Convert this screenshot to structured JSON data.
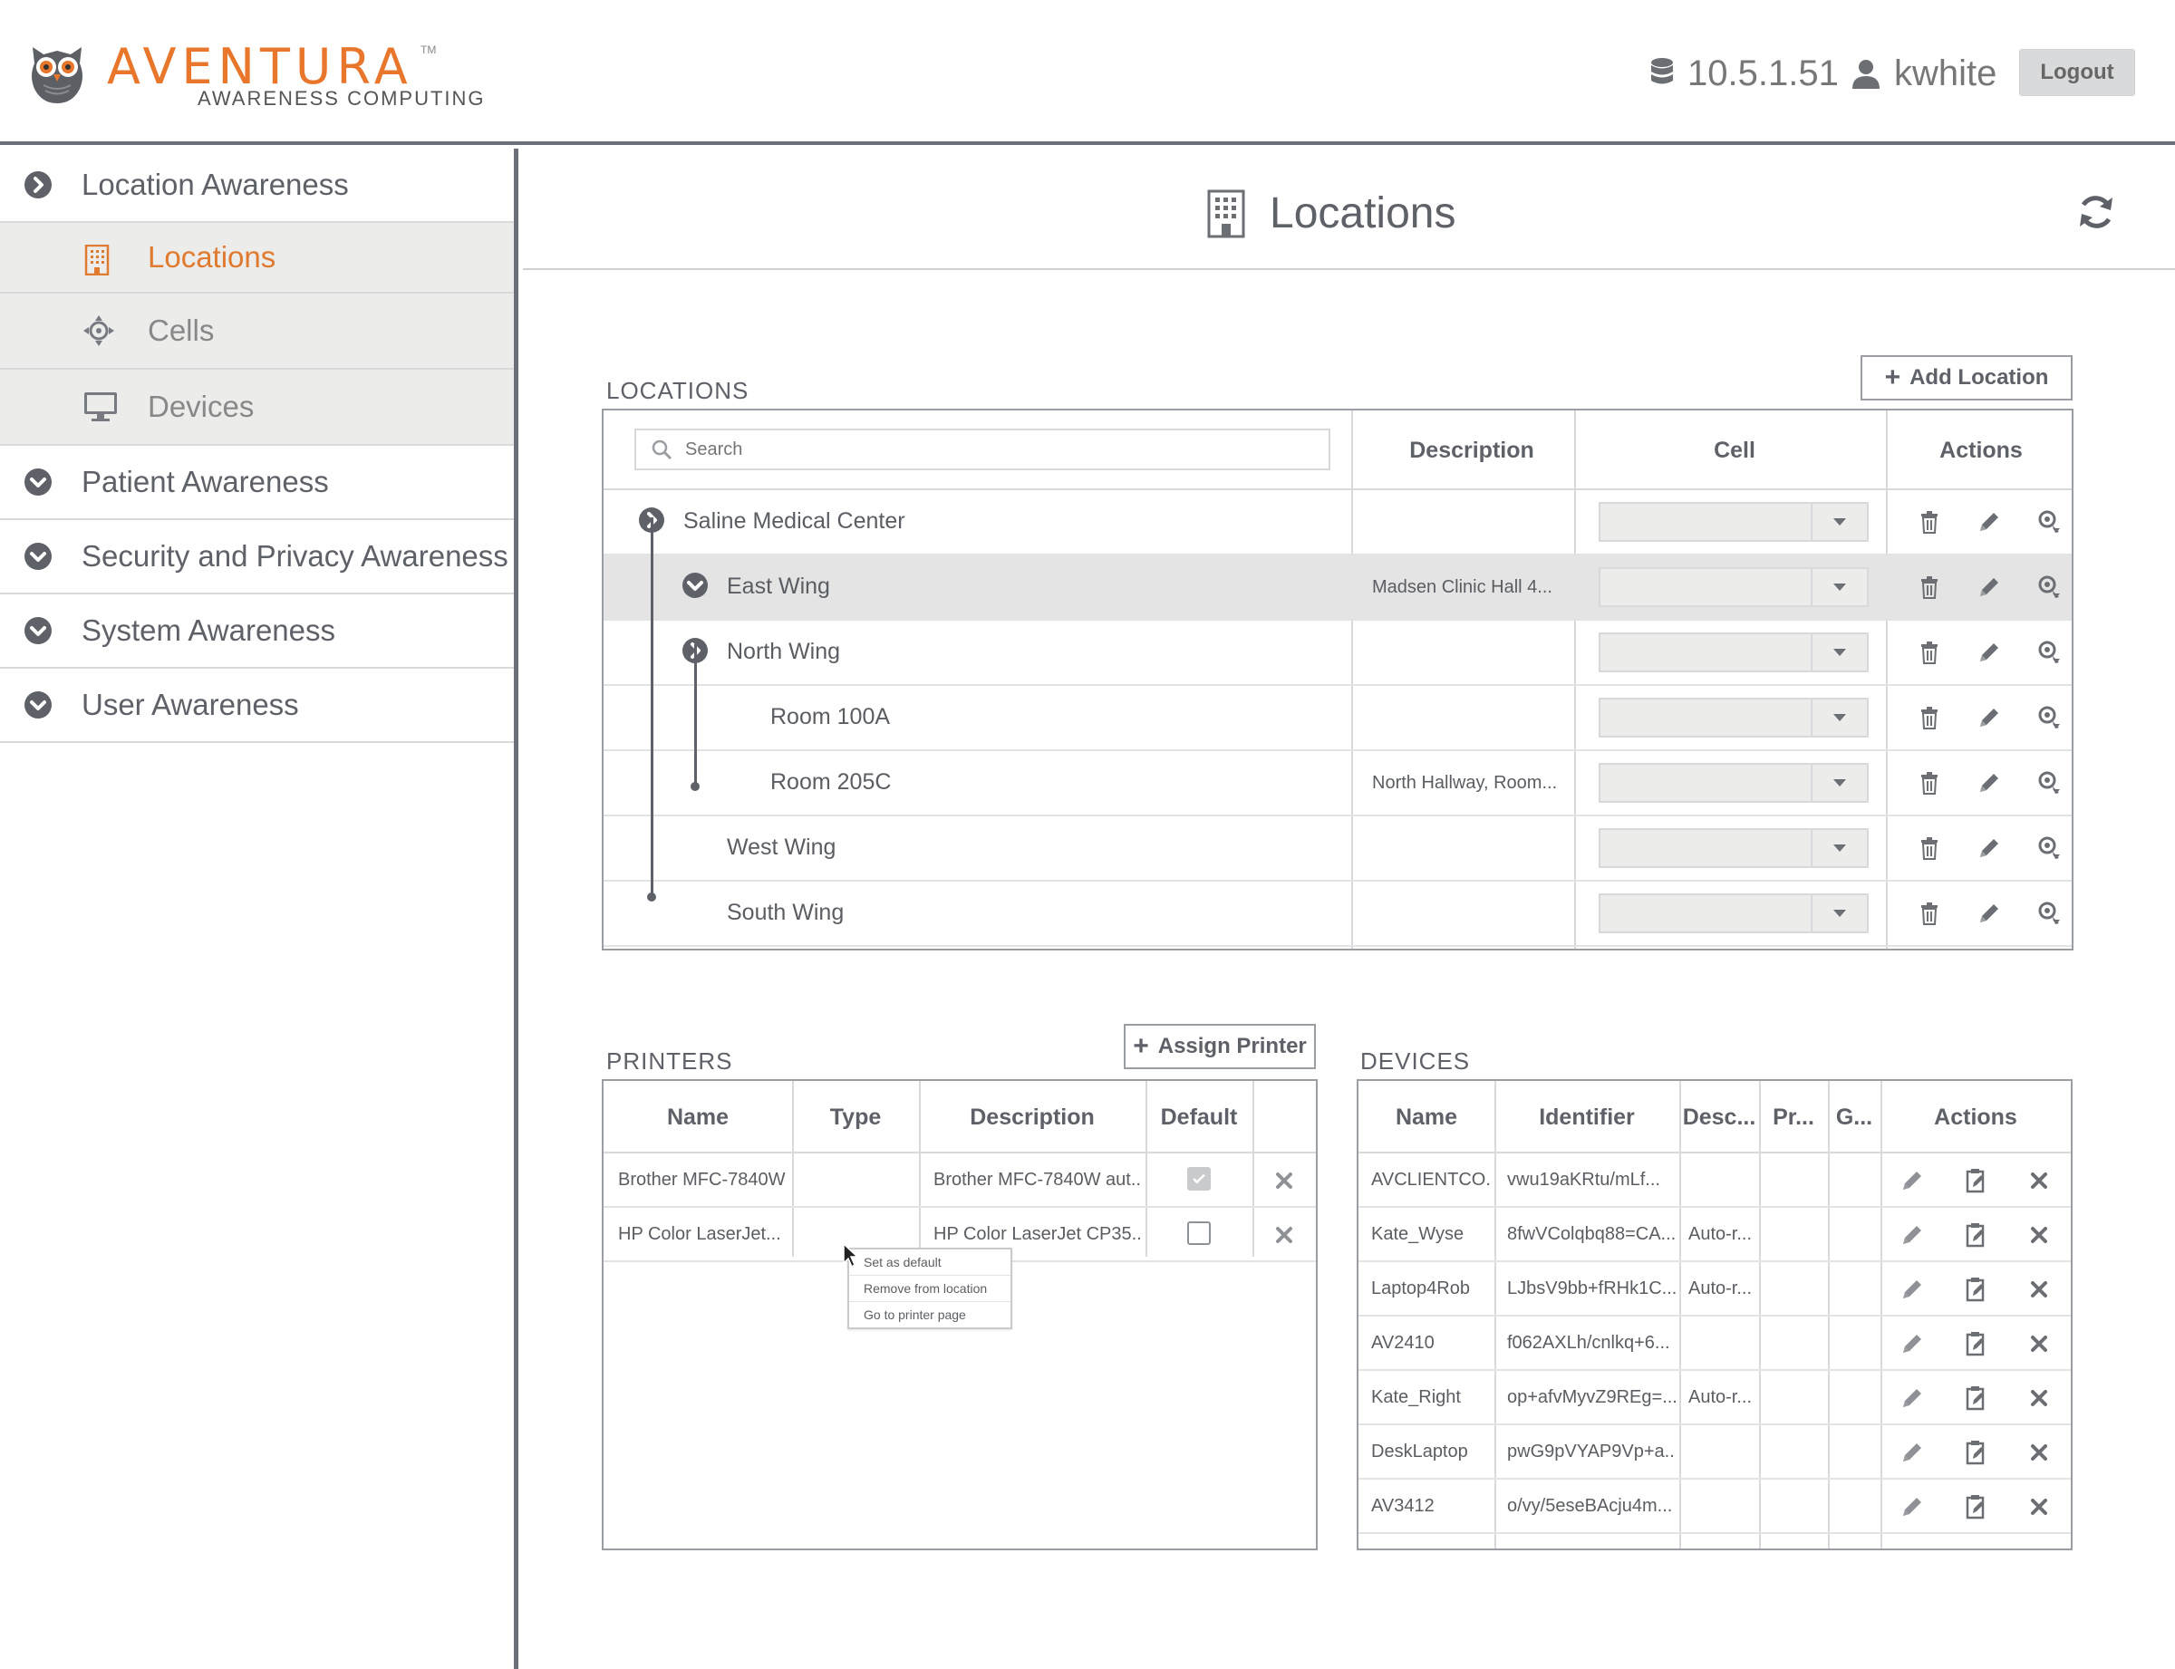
{
  "header": {
    "logo_text": "AVENTURA",
    "logo_tm": "TM",
    "logo_sub": "AWARENESS COMPUTING",
    "server_ip": "10.5.1.51",
    "username": "kwhite",
    "logout_label": "Logout"
  },
  "sidebar": {
    "groups": [
      {
        "label": "Location Awareness",
        "icon": "chevron-right-circle-icon"
      },
      {
        "label": "Patient Awareness",
        "icon": "chevron-down-circle-icon"
      },
      {
        "label": "Security and Privacy Awareness",
        "icon": "chevron-down-circle-icon"
      },
      {
        "label": "System Awareness",
        "icon": "chevron-down-circle-icon"
      },
      {
        "label": "User Awareness",
        "icon": "chevron-down-circle-icon"
      }
    ],
    "sub_items": [
      {
        "label": "Locations",
        "icon": "building-icon",
        "active": true
      },
      {
        "label": "Cells",
        "icon": "crosshair-icon",
        "active": false
      },
      {
        "label": "Devices",
        "icon": "monitor-icon",
        "active": false
      }
    ]
  },
  "page": {
    "title": "Locations"
  },
  "locations": {
    "section_label": "LOCATIONS",
    "add_label": "Add Location",
    "search_placeholder": "Search",
    "headers": {
      "description": "Description",
      "cell": "Cell",
      "actions": "Actions"
    },
    "rows": [
      {
        "name": "Saline Medical Center",
        "description": ""
      },
      {
        "name": "East Wing",
        "description": "Madsen Clinic Hall 4..."
      },
      {
        "name": "North Wing",
        "description": ""
      },
      {
        "name": "Room 100A",
        "description": ""
      },
      {
        "name": "Room 205C",
        "description": "North Hallway, Room..."
      },
      {
        "name": "West Wing",
        "description": ""
      },
      {
        "name": "South Wing",
        "description": ""
      }
    ]
  },
  "printers": {
    "section_label": "PRINTERS",
    "assign_label": "Assign Printer",
    "headers": {
      "name": "Name",
      "type": "Type",
      "description": "Description",
      "default": "Default"
    },
    "rows": [
      {
        "name": "Brother MFC-7840W",
        "type": "",
        "description": "Brother MFC-7840W aut...",
        "default": true
      },
      {
        "name": "HP Color LaserJet...",
        "type": "",
        "description": "HP Color LaserJet CP35...",
        "default": false
      }
    ],
    "context_menu": [
      "Set as default",
      "Remove from location",
      "Go to printer page"
    ]
  },
  "devices": {
    "section_label": "DEVICES",
    "headers": {
      "name": "Name",
      "identifier": "Identifier",
      "desc": "Desc...",
      "pr": "Pr...",
      "g": "G...",
      "actions": "Actions"
    },
    "rows": [
      {
        "name": "AVCLIENTCO...",
        "identifier": "vwu19aKRtu/mLf...",
        "desc": ""
      },
      {
        "name": "Kate_Wyse",
        "identifier": "8fwVColqbq88=CA...",
        "desc": "Auto-r..."
      },
      {
        "name": "Laptop4Rob",
        "identifier": "LJbsV9bb+fRHk1C...",
        "desc": "Auto-r..."
      },
      {
        "name": "AV2410",
        "identifier": "f062AXLh/cnlkq+6...",
        "desc": ""
      },
      {
        "name": "Kate_Right",
        "identifier": "op+afvMyvZ9REg=...",
        "desc": "Auto-r..."
      },
      {
        "name": "DeskLaptop",
        "identifier": "pwG9pVYAP9Vp+a...",
        "desc": ""
      },
      {
        "name": "AV3412",
        "identifier": "o/vy/5eseBAcju4m...",
        "desc": ""
      }
    ]
  },
  "colors": {
    "accent": "#e8762b",
    "border": "#9a9da1",
    "text": "#5e6168",
    "selected_row": "#e3e4e3"
  }
}
